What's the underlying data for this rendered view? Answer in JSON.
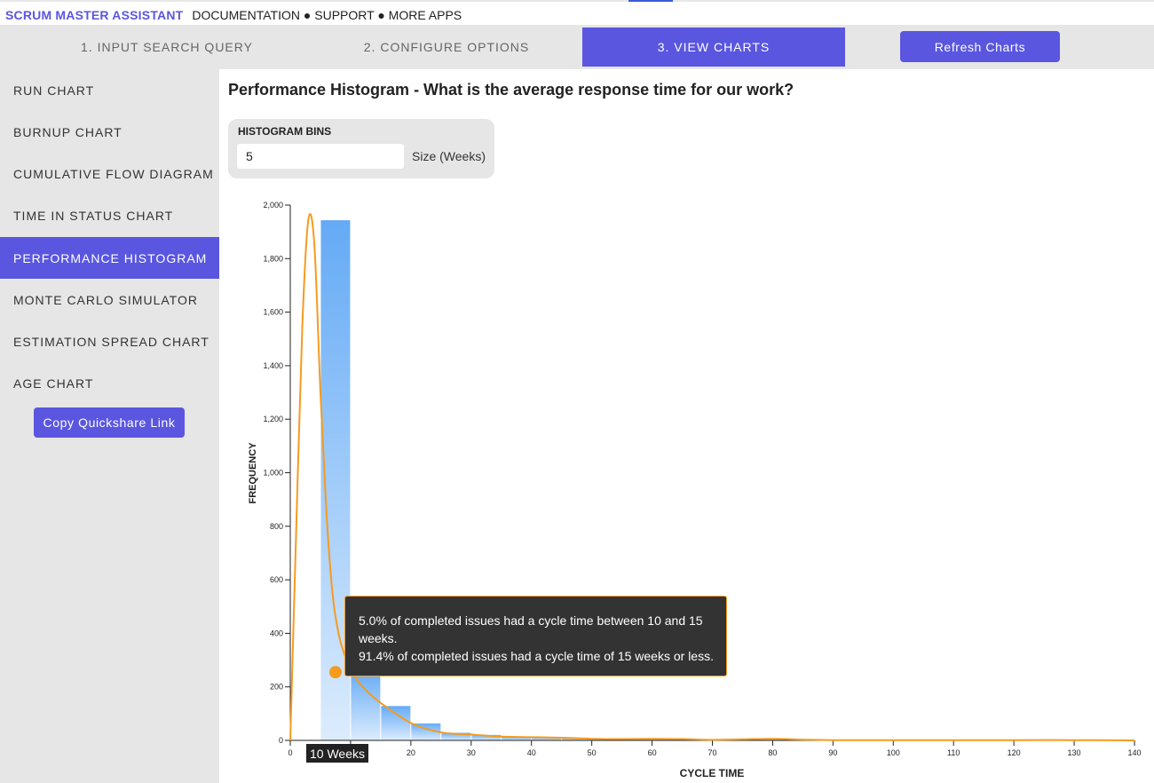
{
  "header": {
    "brand": "SCRUM MASTER ASSISTANT",
    "links": [
      "DOCUMENTATION",
      "SUPPORT",
      "MORE APPS"
    ],
    "separator": "●"
  },
  "steps": [
    {
      "label": "1. INPUT SEARCH QUERY",
      "active": false
    },
    {
      "label": "2. CONFIGURE OPTIONS",
      "active": false
    },
    {
      "label": "3. VIEW CHARTS",
      "active": true
    }
  ],
  "refresh_label": "Refresh Charts",
  "sidebar": {
    "items": [
      {
        "label": "RUN CHART",
        "active": false
      },
      {
        "label": "BURNUP CHART",
        "active": false
      },
      {
        "label": "CUMULATIVE FLOW DIAGRAM",
        "active": false
      },
      {
        "label": "TIME IN STATUS CHART",
        "active": false
      },
      {
        "label": "PERFORMANCE HISTOGRAM",
        "active": true
      },
      {
        "label": "MONTE CARLO SIMULATOR",
        "active": false
      },
      {
        "label": "ESTIMATION SPREAD CHART",
        "active": false
      },
      {
        "label": "AGE CHART",
        "active": false
      }
    ],
    "quickshare_label": "Copy Quickshare Link"
  },
  "page_title": "Performance Histogram - What is the average response time for our work?",
  "bins": {
    "label": "HISTOGRAM BINS",
    "value": "5",
    "unit": "Size (Weeks)"
  },
  "tooltip": {
    "line1": "5.0% of completed issues had a cycle time between 10 and 15 weeks.",
    "line2": "91.4% of completed issues had a cycle time of 15 weeks or less."
  },
  "x_hover_label": "10 Weeks",
  "colors": {
    "accent": "#5a56e0",
    "curve": "#f59b1f",
    "bar_top": "#64aaf5",
    "bar_bottom": "#dcecfd"
  },
  "chart_data": {
    "type": "bar",
    "xlabel": "CYCLE TIME",
    "ylabel": "FREQUENCY",
    "xlim": [
      0,
      140
    ],
    "ylim": [
      0,
      2000
    ],
    "xticks": [
      0,
      10,
      20,
      30,
      40,
      50,
      60,
      70,
      80,
      90,
      100,
      110,
      120,
      130,
      140
    ],
    "yticks": [
      0,
      200,
      400,
      600,
      800,
      1000,
      1200,
      1400,
      1600,
      1800,
      2000
    ],
    "ytick_labels": [
      "0",
      "200",
      "400",
      "600",
      "800",
      "1,000",
      "1,200",
      "1,400",
      "1,600",
      "1,800",
      "2,000"
    ],
    "bin_size": 5,
    "bins": [
      {
        "start": 5,
        "end": 10,
        "value": 1945
      },
      {
        "start": 10,
        "end": 15,
        "value": 265
      },
      {
        "start": 15,
        "end": 20,
        "value": 130
      },
      {
        "start": 20,
        "end": 25,
        "value": 65
      },
      {
        "start": 25,
        "end": 30,
        "value": 30
      },
      {
        "start": 30,
        "end": 35,
        "value": 22
      },
      {
        "start": 35,
        "end": 40,
        "value": 14
      },
      {
        "start": 40,
        "end": 45,
        "value": 12
      },
      {
        "start": 45,
        "end": 50,
        "value": 10
      },
      {
        "start": 50,
        "end": 55,
        "value": 6
      },
      {
        "start": 55,
        "end": 60,
        "value": 5
      },
      {
        "start": 60,
        "end": 65,
        "value": 6
      },
      {
        "start": 65,
        "end": 70,
        "value": 5
      },
      {
        "start": 70,
        "end": 75,
        "value": 2
      },
      {
        "start": 75,
        "end": 80,
        "value": 4
      },
      {
        "start": 80,
        "end": 85,
        "value": 6
      },
      {
        "start": 85,
        "end": 90,
        "value": 3
      },
      {
        "start": 90,
        "end": 95,
        "value": 1
      },
      {
        "start": 95,
        "end": 100,
        "value": 1
      },
      {
        "start": 100,
        "end": 105,
        "value": 1
      },
      {
        "start": 105,
        "end": 110,
        "value": 1
      },
      {
        "start": 110,
        "end": 115,
        "value": 1
      },
      {
        "start": 115,
        "end": 120,
        "value": 1
      },
      {
        "start": 120,
        "end": 125,
        "value": 1
      },
      {
        "start": 125,
        "end": 130,
        "value": 1
      },
      {
        "start": 130,
        "end": 135,
        "value": 1
      },
      {
        "start": 135,
        "end": 140,
        "value": 1
      }
    ],
    "curve": {
      "x": [
        0,
        1,
        2,
        3,
        4,
        5,
        6,
        7,
        8,
        9,
        10,
        12,
        15,
        20,
        25,
        30,
        35,
        40,
        45,
        50,
        55,
        60,
        65,
        70,
        75,
        80,
        85,
        90,
        100,
        110,
        120,
        130,
        140
      ],
      "y": [
        0,
        800,
        1550,
        1945,
        1850,
        1300,
        850,
        550,
        400,
        320,
        265,
        200,
        140,
        65,
        30,
        22,
        14,
        12,
        10,
        6,
        5,
        6,
        5,
        2,
        4,
        6,
        3,
        1,
        1,
        1,
        1,
        1,
        0
      ]
    },
    "highlight": {
      "x": 7.5,
      "y": 255
    }
  }
}
